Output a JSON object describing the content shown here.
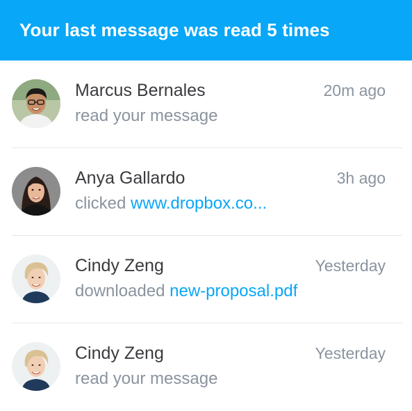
{
  "header": {
    "title": "Your last message was read 5 times",
    "background_color": "#08a7f7"
  },
  "activity": [
    {
      "name": "Marcus Bernales",
      "time": "20m ago",
      "action": "read your message",
      "link": "",
      "avatar_icon": "avatar-man-glasses"
    },
    {
      "name": "Anya Gallardo",
      "time": "3h ago",
      "action": "clicked",
      "link": "www.dropbox.co...",
      "avatar_icon": "avatar-woman-dark-hair"
    },
    {
      "name": "Cindy Zeng",
      "time": "Yesterday",
      "action": "downloaded",
      "link": "new-proposal.pdf",
      "avatar_icon": "avatar-woman-short-hair"
    },
    {
      "name": "Cindy Zeng",
      "time": "Yesterday",
      "action": "read your message",
      "link": "",
      "avatar_icon": "avatar-woman-short-hair"
    }
  ],
  "colors": {
    "link": "#08a7f7",
    "secondary_text": "#8a949f",
    "primary_text": "#3b3b3f"
  }
}
